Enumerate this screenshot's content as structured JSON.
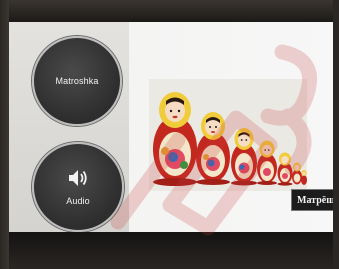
{
  "lesson": {
    "title_button": {
      "label": "Matroshka",
      "icon": "none"
    },
    "audio_button": {
      "label": "Audio",
      "icon": "speaker-icon"
    },
    "picture": {
      "subject": "matryoshka-dolls",
      "doll_count": 7
    },
    "word_tag": {
      "label": "Матрёшка"
    }
  },
  "colors": {
    "button_fill": "#2f2f2f",
    "button_ring": "#bdbdbd",
    "doll_red": "#c3281f",
    "doll_yellow": "#f1cc3a",
    "watermark_red": "#c83a3a"
  }
}
